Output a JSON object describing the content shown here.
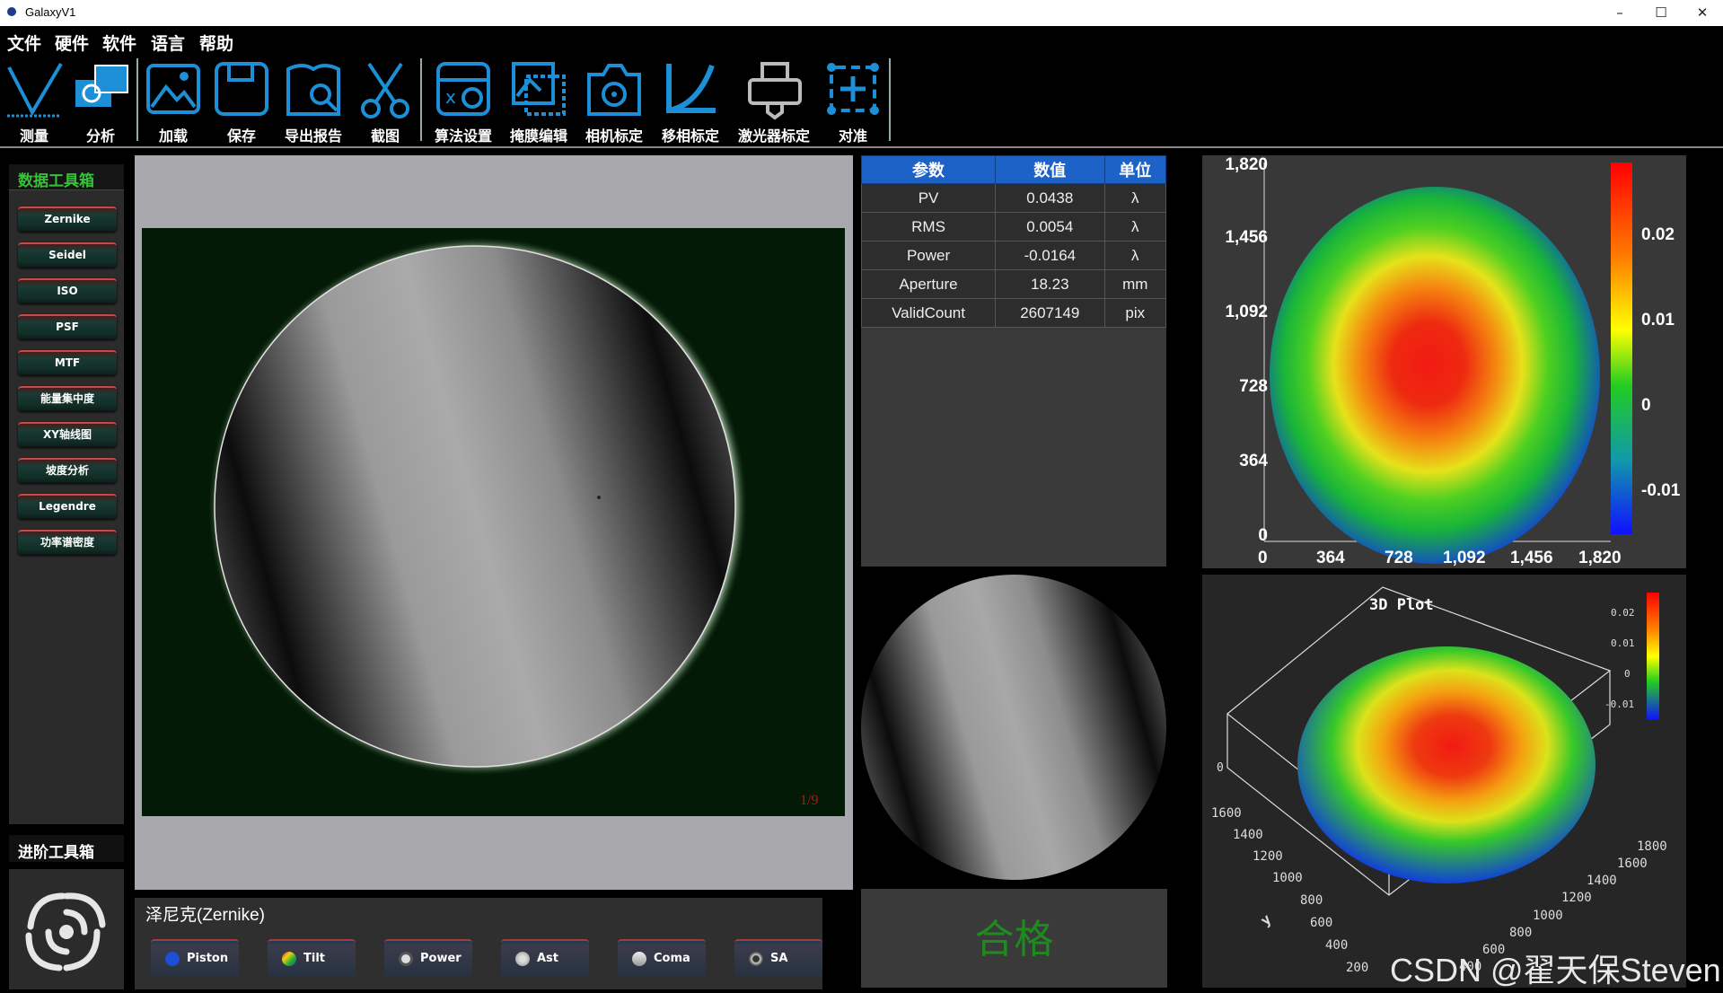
{
  "window": {
    "title": "GalaxyV1",
    "controls": [
      "–",
      "☐",
      "✕"
    ]
  },
  "menu": [
    "文件",
    "硬件",
    "软件",
    "语言",
    "帮助"
  ],
  "toolbar": [
    {
      "label": "测量",
      "icon": "measure-icon"
    },
    {
      "label": "分析",
      "icon": "analyze-icon"
    },
    {
      "label": "加载",
      "icon": "load-image-icon"
    },
    {
      "label": "保存",
      "icon": "save-icon"
    },
    {
      "label": "导出报告",
      "icon": "export-report-icon"
    },
    {
      "label": "截图",
      "icon": "scissors-icon"
    },
    {
      "label": "算法设置",
      "icon": "algorithm-settings-icon"
    },
    {
      "label": "掩膜编辑",
      "icon": "mask-edit-icon"
    },
    {
      "label": "相机标定",
      "icon": "camera-calibration-icon"
    },
    {
      "label": "移相标定",
      "icon": "phase-shift-calibration-icon"
    },
    {
      "label": "激光器标定",
      "icon": "laser-calibration-icon"
    },
    {
      "label": "对准",
      "icon": "alignment-icon"
    }
  ],
  "data_toolbox": {
    "title": "数据工具箱",
    "items": [
      "Zernike",
      "Seidel",
      "ISO",
      "PSF",
      "MTF",
      "能量集中度",
      "XY轴线图",
      "坡度分析",
      "Legendre",
      "功率谱密度"
    ]
  },
  "advanced_toolbox": {
    "title": "进阶工具箱"
  },
  "image_view": {
    "frame_counter": "1/9"
  },
  "zernike_panel": {
    "title": "泽尼克(Zernike)",
    "buttons": [
      "Piston",
      "Tilt",
      "Power",
      "Ast",
      "Coma",
      "SA"
    ]
  },
  "params_table": {
    "headers": [
      "参数",
      "数值",
      "单位"
    ],
    "rows": [
      [
        "PV",
        "0.0438",
        "λ"
      ],
      [
        "RMS",
        "0.0054",
        "λ"
      ],
      [
        "Power",
        "-0.0164",
        "λ"
      ],
      [
        "Aperture",
        "18.23",
        "mm"
      ],
      [
        "ValidCount",
        "2607149",
        "pix"
      ]
    ]
  },
  "result": {
    "text": "合格",
    "color": "#1f8a1f"
  },
  "surface_map": {
    "x_ticks": [
      "0",
      "364",
      "728",
      "1,092",
      "1,456",
      "1,820"
    ],
    "y_ticks": [
      "1,820",
      "1,456",
      "1,092",
      "728",
      "364",
      "0"
    ],
    "colorbar_ticks": [
      "0.02",
      "0.01",
      "0",
      "-0.01"
    ]
  },
  "plot3d": {
    "title": "3D Plot",
    "colorbar_ticks": [
      "0.02",
      "0.01",
      "0",
      "-0.01"
    ],
    "z_tick": "0",
    "y_axis_label": "y",
    "left_ticks": [
      "1600",
      "1400",
      "1200",
      "1000",
      "800",
      "600",
      "400",
      "200"
    ],
    "right_ticks": [
      "1800",
      "1600",
      "1400",
      "1200",
      "1000",
      "800",
      "600",
      "400"
    ]
  },
  "watermark": "CSDN @翟天保Steven",
  "colors": {
    "table_header": "#1c62c7",
    "toolbar_icon": "#1d8fd6",
    "result_green": "#1f8a1f"
  }
}
